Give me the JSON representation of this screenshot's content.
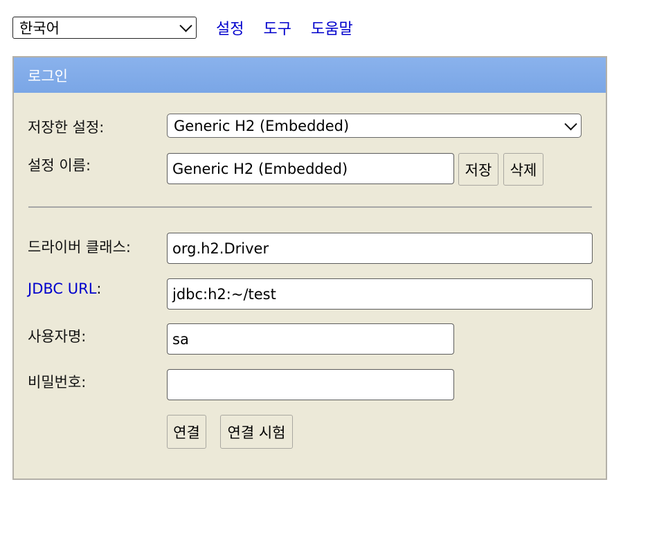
{
  "topbar": {
    "language": "한국어",
    "links": [
      "설정",
      "도구",
      "도움말"
    ]
  },
  "panel": {
    "title": "로그인",
    "saved_settings_label": "저장한 설정:",
    "saved_settings_value": "Generic H2 (Embedded)",
    "setting_name_label": "설정 이름:",
    "setting_name_value": "Generic H2 (Embedded)",
    "save_button": "저장",
    "delete_button": "삭제",
    "driver_class_label": "드라이버 클래스:",
    "driver_class_value": "org.h2.Driver",
    "jdbc_url_link": "JDBC URL",
    "jdbc_url_colon": ":",
    "jdbc_url_value": "jdbc:h2:~/test",
    "username_label": "사용자명:",
    "username_value": "sa",
    "password_label": "비밀번호:",
    "password_value": "",
    "connect_button": "연결",
    "test_connection_button": "연결 시험"
  },
  "colors": {
    "link": "#0000cc",
    "panel_background": "#ece9d8",
    "header_background": "#7aa6e6"
  }
}
